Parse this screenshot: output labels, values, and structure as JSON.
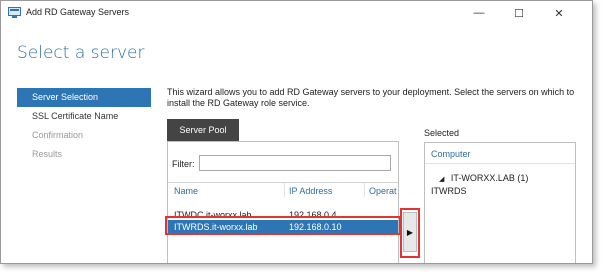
{
  "window": {
    "title": "Add RD Gateway Servers",
    "controls": {
      "minimize": "—",
      "maximize": "☐",
      "close": "✕"
    }
  },
  "page_title": "Select a server",
  "nav": [
    {
      "label": "Server Selection",
      "state": "active"
    },
    {
      "label": "SSL Certificate Name",
      "state": "enabled"
    },
    {
      "label": "Confirmation",
      "state": "disabled"
    },
    {
      "label": "Results",
      "state": "disabled"
    }
  ],
  "description": "This wizard allows you to add RD Gateway servers to your deployment. Select the servers on which to install the RD Gateway role service.",
  "pool": {
    "tab_label": "Server Pool",
    "filter_label": "Filter:",
    "filter_value": "",
    "columns": {
      "name": "Name",
      "ip": "IP Address",
      "operating": "Operat"
    },
    "rows": [
      {
        "name": "ITWDC.it-worxx.lab",
        "ip": "192.168.0.4"
      },
      {
        "name": "ITWRDS.it-worxx.lab",
        "ip": "192.168.0.10"
      }
    ]
  },
  "add_button": "▶",
  "selected": {
    "label": "Selected",
    "column": "Computer",
    "group": "IT-WORXX.LAB (1)",
    "items": [
      "ITWRDS"
    ]
  },
  "colors": {
    "accent": "#2e75b6",
    "title": "#2e6e9e",
    "tab": "#444444",
    "highlight_box": "#e53333"
  },
  "icons": {
    "app": "server-icon",
    "expand": "triangle-expanded-icon"
  }
}
